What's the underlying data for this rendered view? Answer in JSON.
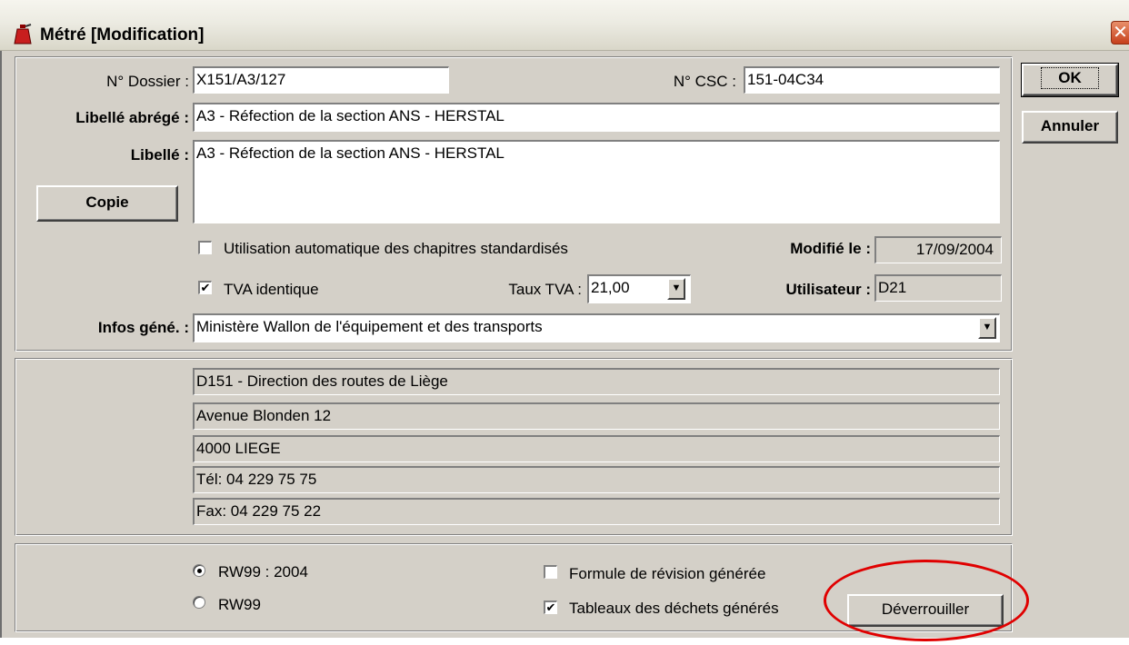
{
  "window": {
    "title": "Métré [Modification]",
    "close_glyph": "✕"
  },
  "form": {
    "dossier_label": "N° Dossier :",
    "dossier_value": "X151/A3/127",
    "csc_label": "N° CSC :",
    "csc_value": "151-04C34",
    "libelle_abrege_label": "Libellé abrégé :",
    "libelle_abrege_value": "A3 - Réfection de la section ANS - HERSTAL",
    "libelle_label": "Libellé :",
    "libelle_value": "A3 - Réfection de la section ANS - HERSTAL",
    "copie_button": "Copie",
    "chapitres_label": "Utilisation automatique des chapitres standardisés",
    "chapitres_checked": false,
    "modifie_label": "Modifié le :",
    "modifie_value": "17/09/2004",
    "tva_identique_label": "TVA identique",
    "tva_identique_checked": true,
    "taux_tva_label": "Taux TVA :",
    "taux_tva_value": "21,00",
    "utilisateur_label": "Utilisateur :",
    "utilisateur_value": "D21",
    "infos_label": "Infos géné. :",
    "infos_value": "Ministère Wallon de l'équipement et des transports"
  },
  "address": {
    "lines": [
      "D151 - Direction des routes de Liège",
      "Avenue Blonden 12",
      "4000   LIEGE",
      "Tél: 04 229 75 75",
      "Fax: 04 229 75 22"
    ]
  },
  "bottom": {
    "radio_1_label": "RW99 : 2004",
    "radio_1_selected": true,
    "radio_2_label": "RW99",
    "radio_2_selected": false,
    "formule_label": "Formule de révision générée",
    "formule_checked": false,
    "tableaux_label": "Tableaux des déchets générés",
    "tableaux_checked": true,
    "deverrouiller_button": "Déverrouiller"
  },
  "side_buttons": {
    "ok": "OK",
    "annuler": "Annuler"
  },
  "icons": {
    "app": "fire-extinguisher-icon",
    "dropdown": "chevron-down-icon",
    "check": "checkmark-icon"
  },
  "colors": {
    "dialog_face": "#d4d0c8",
    "highlight": "#e00000",
    "close_button": "#c6401c"
  }
}
